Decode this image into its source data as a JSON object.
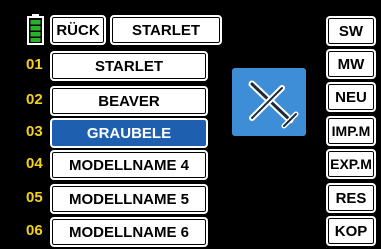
{
  "header": {
    "back_label": "RÜCK",
    "model_name": "STARLET"
  },
  "battery": {
    "icon": "battery-icon",
    "color": "#2bb02b",
    "level": 1.0
  },
  "model_list": {
    "selected_index": 2,
    "selected_color": "#1f5fb0",
    "rows": [
      {
        "num": "01",
        "name": "STARLET"
      },
      {
        "num": "02",
        "name": "BEAVER"
      },
      {
        "num": "03",
        "name": "GRAUBELE"
      },
      {
        "num": "04",
        "name": "MODELLNAME 4"
      },
      {
        "num": "05",
        "name": "MODELLNAME 5"
      },
      {
        "num": "06",
        "name": "MODELLNAME 6"
      }
    ]
  },
  "model_icon": {
    "icon": "glider-icon",
    "color": "#3d8ed6"
  },
  "side_buttons": [
    {
      "label": "SW"
    },
    {
      "label": "MW"
    },
    {
      "label": "NEU"
    },
    {
      "label": "IMP.M"
    },
    {
      "label": "EXP.M"
    },
    {
      "label": "RES"
    },
    {
      "label": "KOP"
    }
  ],
  "colors": {
    "background": "#000000",
    "row_number": "#f2d21b",
    "button_bg": "#ffffff"
  }
}
